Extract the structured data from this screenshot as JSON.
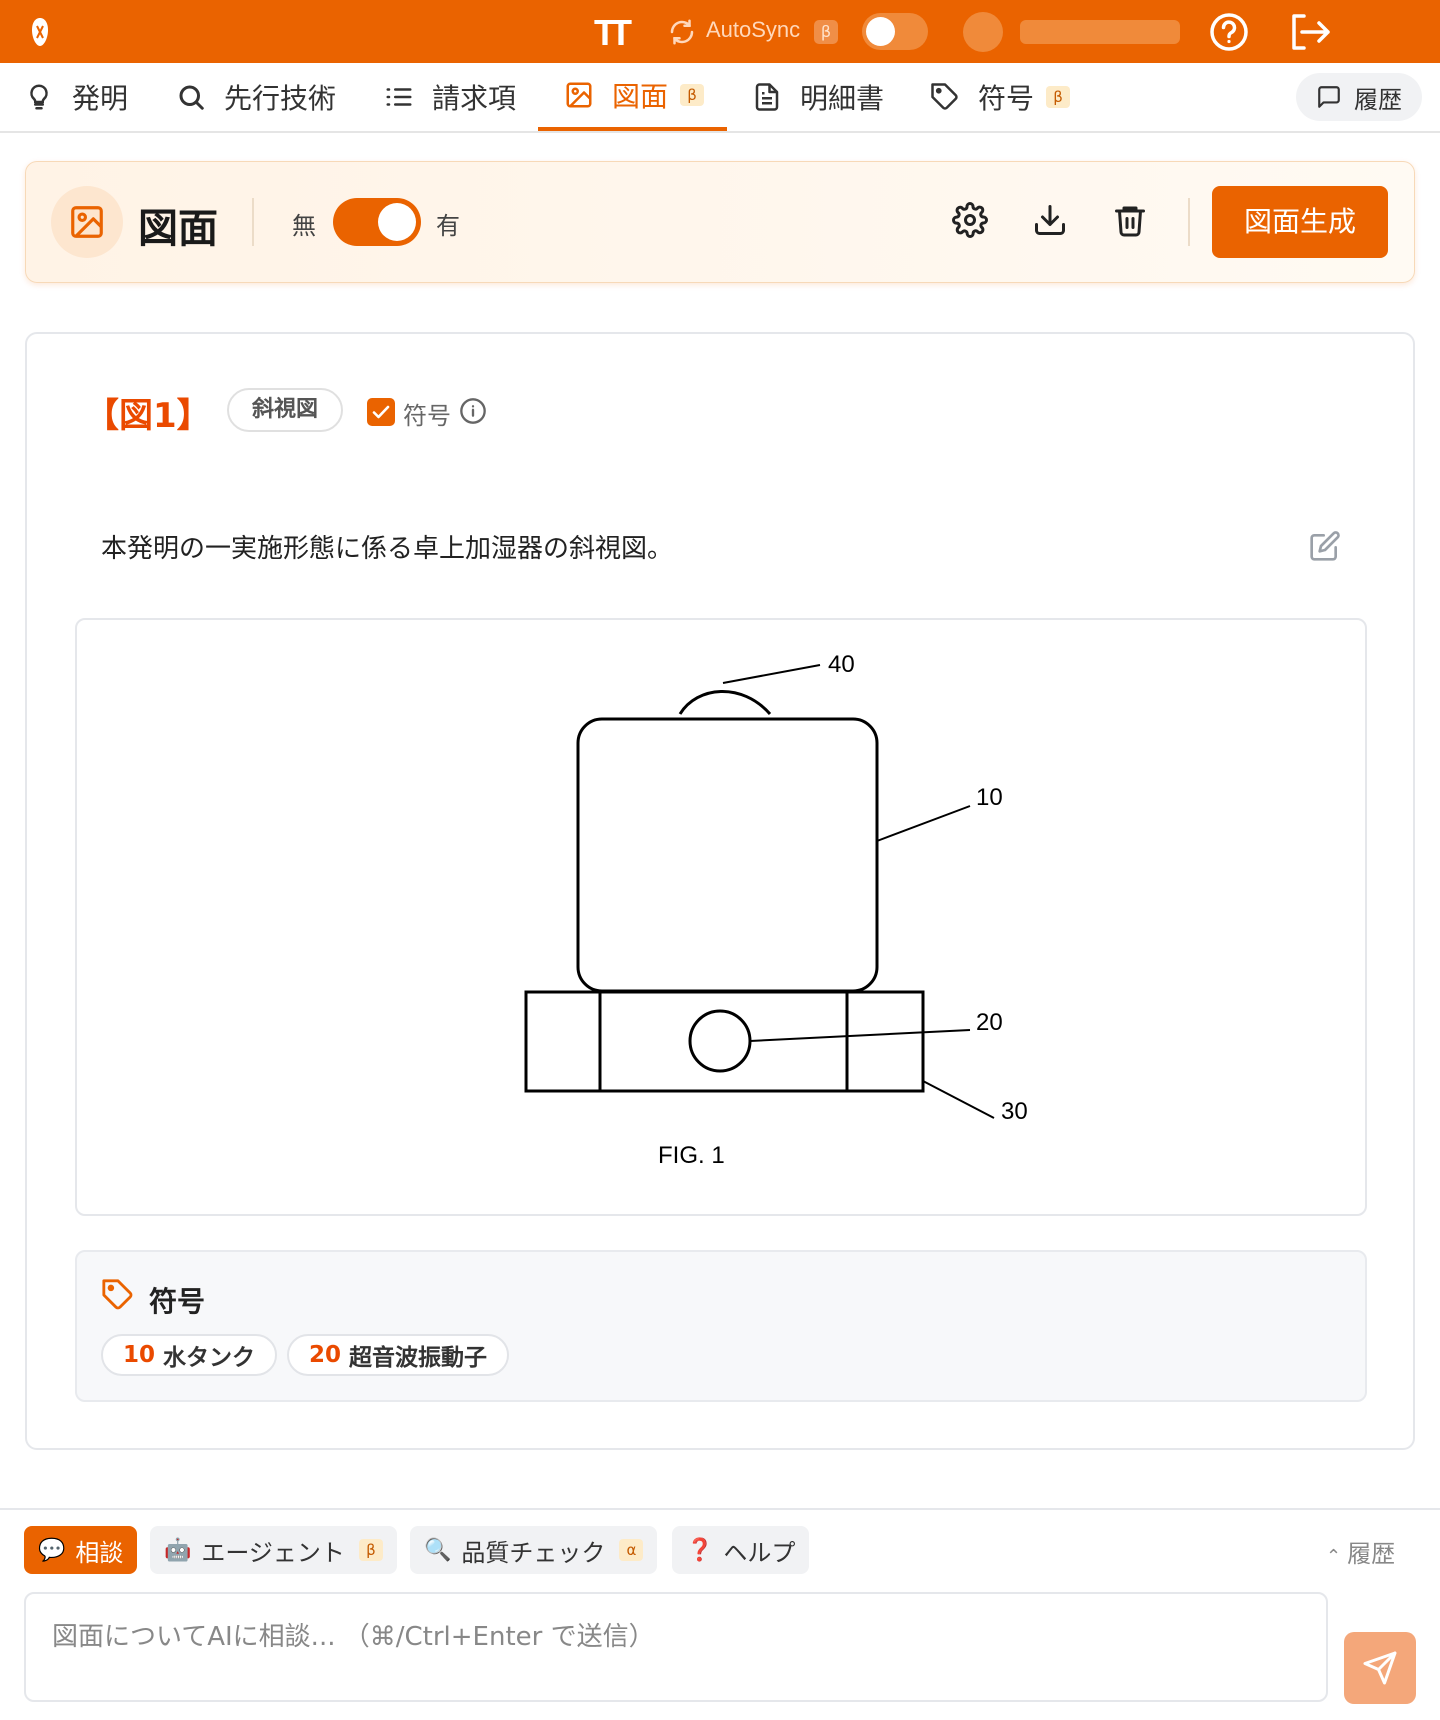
{
  "topbar": {
    "tt_label": "TT",
    "autosync_label": "AutoSync",
    "autosync_badge": "β",
    "autosync_on": false,
    "icons": [
      "logo-icon",
      "text-size-icon",
      "sync-icon",
      "help-icon",
      "logout-icon"
    ]
  },
  "tabs": [
    {
      "label": "発明",
      "icon": "lightbulb-icon"
    },
    {
      "label": "先行技術",
      "icon": "search-icon"
    },
    {
      "label": "請求項",
      "icon": "list-icon"
    },
    {
      "label": "図面",
      "icon": "image-icon",
      "badge": "β",
      "active": true
    },
    {
      "label": "明細書",
      "icon": "document-icon"
    },
    {
      "label": "符号",
      "icon": "tag-icon",
      "badge": "β"
    }
  ],
  "history_tab": "履歴",
  "header": {
    "title": "図面",
    "toggle_off": "無",
    "toggle_on": "有",
    "toggle_state": true,
    "generate_button": "図面生成",
    "icons": [
      "settings-icon",
      "download-icon",
      "trash-icon"
    ]
  },
  "figure": {
    "label": "【図1】",
    "view_type": "斜視図",
    "show_refs_label": "符号",
    "show_refs_checked": true,
    "description": "本発明の一実施形態に係る卓上加湿器の斜視図。",
    "drawing": {
      "callouts": [
        "40",
        "10",
        "20",
        "30"
      ],
      "caption": "FIG. 1"
    }
  },
  "references": {
    "title": "符号",
    "items": [
      {
        "num": "10",
        "name": "水タンク"
      },
      {
        "num": "20",
        "name": "超音波振動子"
      }
    ]
  },
  "bottom": {
    "chips": [
      {
        "emoji": "💬",
        "label": "相談",
        "active": true
      },
      {
        "emoji": "🤖",
        "label": "エージェント",
        "badge": "β"
      },
      {
        "emoji": "🔍",
        "label": "品質チェック",
        "badge": "α"
      },
      {
        "emoji": "❓",
        "label": "ヘルプ"
      }
    ],
    "history_link": "履歴",
    "chat_placeholder": "図面についてAIに相談... （⌘/Ctrl+Enter で送信）"
  },
  "colors": {
    "accent": "#ea6300",
    "accent_light": "#fde6cf",
    "reference_number": "#ea4a00"
  }
}
